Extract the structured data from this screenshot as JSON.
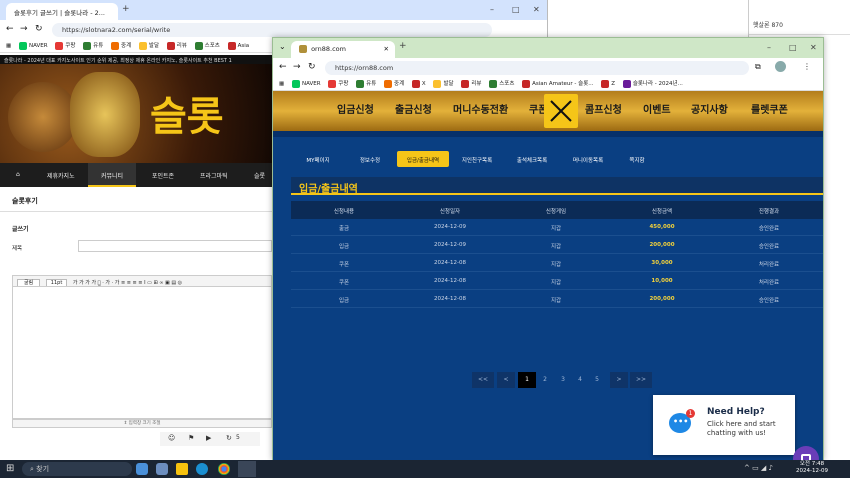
{
  "desktop": {
    "side_label": "햇살론 870"
  },
  "back_window": {
    "tab_title": "슬롯후기 글쓰기 | 슬롯나라 - 2...",
    "url": "https://slotnara2.com/serial/write",
    "bookmarks": [
      "NAVER",
      "쿠팡",
      "유튜",
      "중계",
      "발달",
      "리뷰",
      "스포츠",
      "Asia"
    ],
    "ticker": "슬롯나라 - 2024년 대표 카지노사이트 인기 순위 제공, 최정상 제휴 온라인 카지노, 슬롯사이트 추천 BEST 1",
    "banner_text": "슬롯",
    "nav": [
      "제휴카지노",
      "커뮤니티",
      "포인트존",
      "프라그마틱",
      "슬롯"
    ],
    "section_title": "슬롯후기",
    "write_label": "글쓰기",
    "subject_label": "제목",
    "editor_font": "굴림",
    "editor_size": "11pt",
    "editor_footer": "⇕ 입력창 크기 조절",
    "bottom_count": "5"
  },
  "front_window": {
    "tab_title": "orn88.com",
    "url": "https://orn88.com",
    "bookmarks": [
      "NAVER",
      "쿠팡",
      "유튜",
      "중계",
      "X",
      "발달",
      "리뷰",
      "스포츠",
      "Asian Amateur - 슬롯...",
      "Z",
      "슬롯나라 - 2024년..."
    ],
    "top_nav": [
      "입금신청",
      "출금신청",
      "머니수동전환",
      "쿠폰",
      "콤프신청",
      "이벤트",
      "공지사항",
      "룰렛쿠폰"
    ],
    "sub_tabs": [
      "MY페이지",
      "정보수정",
      "입금/출금내역",
      "지인친구목록",
      "출석체크목록",
      "머니이동목록",
      "쪽지함"
    ],
    "active_sub_tab": "입금/출금내역",
    "page_title": "입금/출금내역",
    "table": {
      "headers": [
        "신청내용",
        "신청일자",
        "신청게임",
        "신청금액",
        "진행결과"
      ],
      "rows": [
        [
          "출금",
          "2024-12-09",
          "지갑",
          "450,000",
          "승인완료"
        ],
        [
          "입금",
          "2024-12-09",
          "지갑",
          "200,000",
          "승인완료"
        ],
        [
          "쿠폰",
          "2024-12-08",
          "지갑",
          "30,000",
          "처리완료"
        ],
        [
          "쿠폰",
          "2024-12-08",
          "지갑",
          "10,000",
          "처리완료"
        ],
        [
          "입금",
          "2024-12-08",
          "지갑",
          "200,000",
          "승인완료"
        ]
      ]
    },
    "pagination": [
      "<<",
      "<",
      "1",
      "2",
      "3",
      "4",
      "5",
      ">",
      ">>"
    ],
    "current_page": "1",
    "help": {
      "title": "Need Help?",
      "body": "Click here and start chatting with us!",
      "badge": "1"
    }
  },
  "taskbar": {
    "search": "찾기",
    "time": "오전 7:48",
    "date": "2024-12-09"
  },
  "colors": {
    "accent_gold": "#f5c518",
    "site_blue": "#0a3f82",
    "amount_yellow": "#f3d23b"
  }
}
